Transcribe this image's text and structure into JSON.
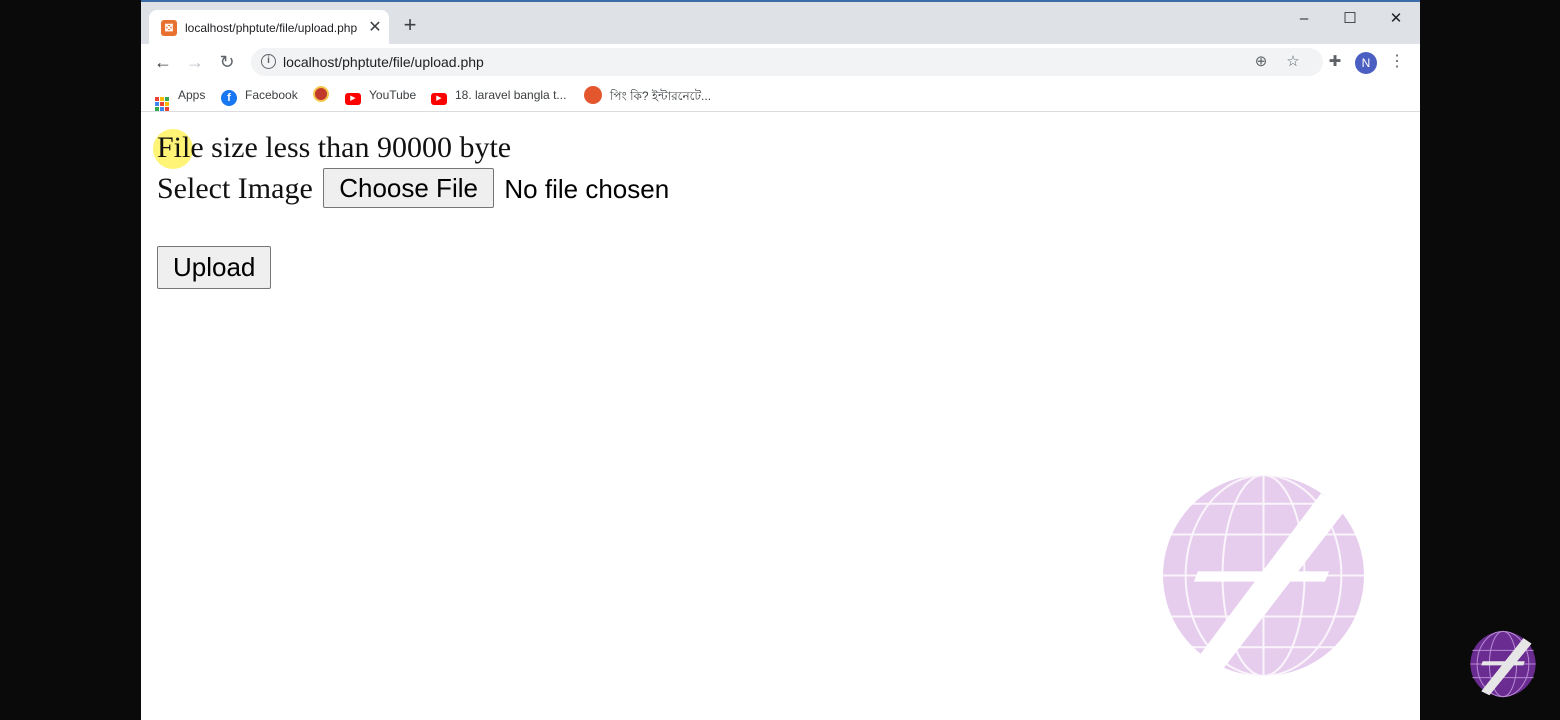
{
  "browser": {
    "tab_title": "localhost/phptute/file/upload.php",
    "tab_favicon": "xampp-icon",
    "new_tab_label": "+",
    "url": "localhost/phptute/file/upload.php",
    "avatar_initial": "N"
  },
  "bookmarks": [
    {
      "label": "Apps",
      "icon": "apps-grid-icon"
    },
    {
      "label": "Facebook",
      "icon": "facebook-icon",
      "color": "#1877f2"
    },
    {
      "label": "",
      "icon": "site-icon"
    },
    {
      "label": "YouTube",
      "icon": "youtube-icon",
      "color": "#ff0000"
    },
    {
      "label": "18. laravel bangla t...",
      "icon": "youtube-icon",
      "color": "#ff0000"
    },
    {
      "label": "পিং কি? ইন্টারনেটে...",
      "icon": "site-icon"
    }
  ],
  "page": {
    "size_note": "File size less than 90000 byte",
    "select_label": "Select Image",
    "choose_file_button": "Choose File",
    "no_file_text": "No file chosen",
    "upload_button": "Upload"
  },
  "colors": {
    "titlebar": "#dee1e6",
    "watermark": "#d9b3e6"
  }
}
